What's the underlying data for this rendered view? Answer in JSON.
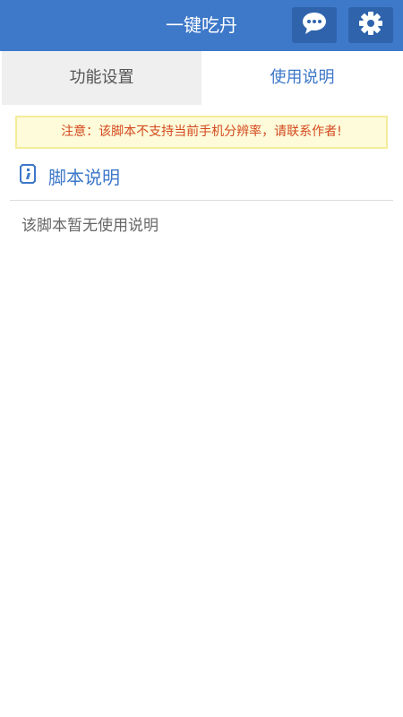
{
  "header": {
    "title": "一键吃丹",
    "chat_icon": "chat-bubble-icon",
    "settings_icon": "gear-icon",
    "accent": "#3d78c9"
  },
  "tabs": [
    {
      "label": "功能设置",
      "active": false
    },
    {
      "label": "使用说明",
      "active": true
    }
  ],
  "notice": {
    "text": "注意：该脚本不支持当前手机分辨率，请联系作者!",
    "color": "#d4481f"
  },
  "section": {
    "icon": "info-document-icon",
    "title": "脚本说明",
    "body": "该脚本暂无使用说明"
  }
}
